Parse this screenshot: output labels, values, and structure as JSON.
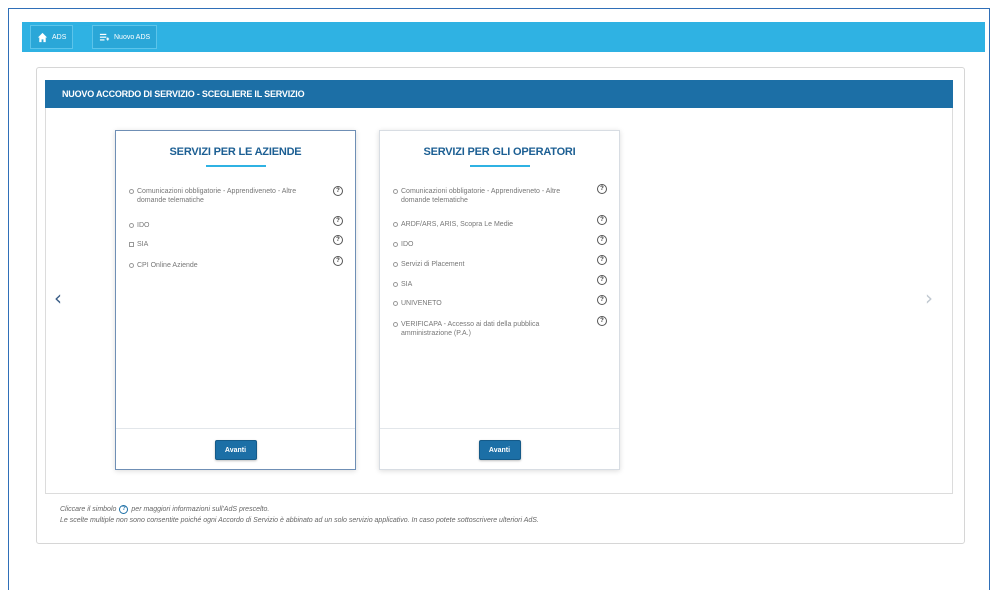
{
  "topbar": {
    "home_label": "ADS",
    "new_label": "Nuovo ADS"
  },
  "header": {
    "title": "NUOVO ACCORDO DI SERVIZIO - SCEGLIERE IL SERVIZIO"
  },
  "cards": [
    {
      "title": "SERVIZI PER LE AZIENDE",
      "button": "Avanti",
      "options": [
        {
          "label": "Comunicazioni obbligatorie - Apprendiveneto - Altre domande telematiche",
          "type": "radio"
        },
        {
          "label": "IDO",
          "type": "radio"
        },
        {
          "label": "SIA",
          "type": "checkbox"
        },
        {
          "label": "CPI Online Aziende",
          "type": "radio"
        }
      ]
    },
    {
      "title": "SERVIZI PER GLI OPERATORI",
      "button": "Avanti",
      "options": [
        {
          "label": "Comunicazioni obbligatorie - Apprendiveneto - Altre domande telematiche",
          "type": "radio"
        },
        {
          "label": "ARDF/ARS, ARIS, Scopra Le Medie",
          "type": "radio"
        },
        {
          "label": "IDO",
          "type": "radio"
        },
        {
          "label": "Servizi di Placement",
          "type": "radio"
        },
        {
          "label": "SIA",
          "type": "radio"
        },
        {
          "label": "UNIVENETO",
          "type": "radio"
        },
        {
          "label": "VERIFICAPA - Accesso ai dati della pubblica amministrazione (P.A.)",
          "type": "radio"
        }
      ]
    }
  ],
  "help_symbol": "?",
  "notes": {
    "line1_prefix": "Cliccare il simbolo",
    "line1_suffix": "per maggiori informazioni sull'AdS prescelto.",
    "line2": "Le scelte multiple non sono consentite poiché ogni Accordo di Servizio è abbinato ad un solo servizio applicativo. In caso potete sottoscrivere ulteriori AdS."
  },
  "nav": {
    "prev": "‹",
    "next": "›"
  }
}
